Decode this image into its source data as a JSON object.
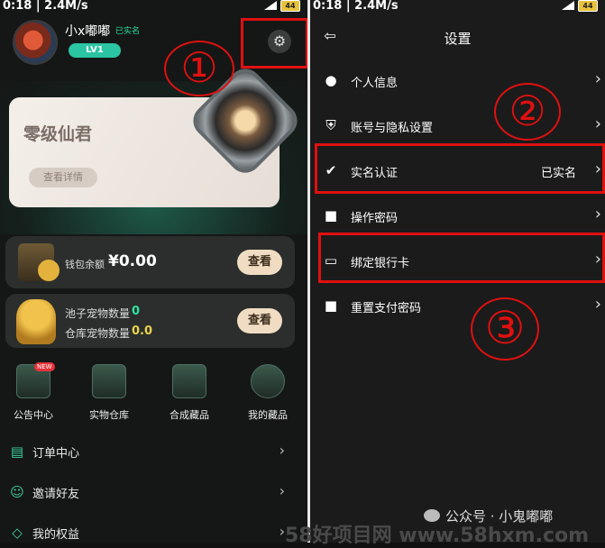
{
  "status": {
    "time": "0:18",
    "speed": "2.4M/s",
    "battery": "44"
  },
  "left": {
    "user": {
      "name": "小x嘟嘟",
      "verified": "已实名",
      "level": "LV1"
    },
    "banner": {
      "title": "零级仙君",
      "button": "查看详情"
    },
    "wallet": {
      "label": "钱包余额",
      "value": "¥0.00",
      "button": "查看"
    },
    "pets": {
      "pool_label": "池子宠物数量",
      "pool_value": "0",
      "store_label": "仓库宠物数量",
      "store_value": "0.0",
      "button": "查看"
    },
    "grid": [
      {
        "label": "公告中心",
        "badge": "NEW"
      },
      {
        "label": "实物仓库"
      },
      {
        "label": "合成藏品"
      },
      {
        "label": "我的藏品"
      }
    ],
    "list": [
      {
        "label": "订单中心"
      },
      {
        "label": "邀请好友"
      },
      {
        "label": "我的权益"
      }
    ]
  },
  "right": {
    "title": "设置",
    "rows": [
      {
        "label": "个人信息",
        "value": ""
      },
      {
        "label": "账号与隐私设置",
        "value": ""
      },
      {
        "label": "实名认证",
        "value": "已实名"
      },
      {
        "label": "操作密码",
        "value": ""
      },
      {
        "label": "绑定银行卡",
        "value": ""
      },
      {
        "label": "重置支付密码",
        "value": ""
      }
    ]
  },
  "annotations": {
    "one": "①",
    "two": "②",
    "three": "③"
  },
  "watermark": {
    "text": "公众号 · 小鬼嘟嘟",
    "site": "58好项目网 www.58hxm.com"
  },
  "colors": {
    "highlight_red": "#e01010",
    "accent_green": "#2ee0a0",
    "button_cream": "#f0dcc2"
  }
}
